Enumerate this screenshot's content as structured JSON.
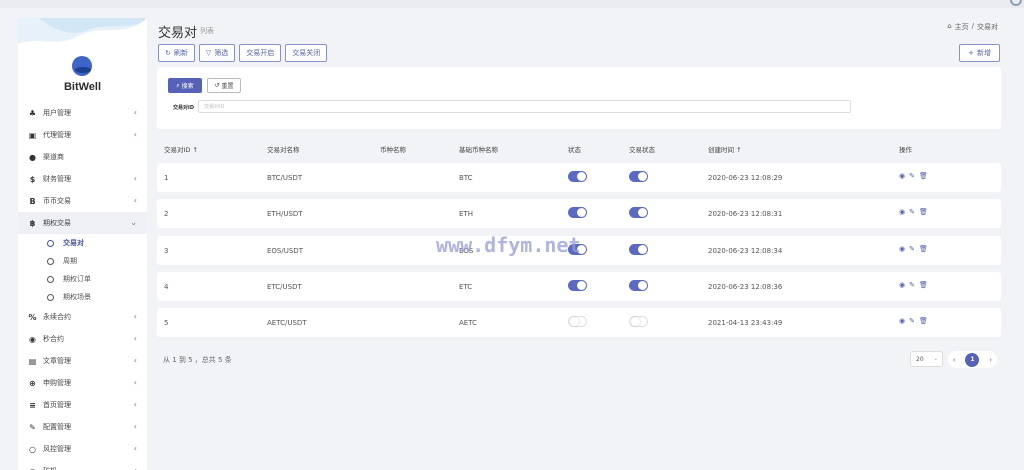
{
  "app": {
    "brand": "BitWell"
  },
  "sidebar": {
    "items": [
      {
        "icon": "♣",
        "label": "用户管理",
        "chevron": "‹"
      },
      {
        "icon": "▣",
        "label": "代理管理",
        "chevron": "‹"
      },
      {
        "icon": "●",
        "label": "渠道商",
        "chevron": ""
      },
      {
        "icon": "$",
        "label": "财务管理",
        "chevron": "‹"
      },
      {
        "icon": "B",
        "label": "币币交易",
        "chevron": "‹"
      },
      {
        "icon": "฿",
        "label": "期权交易",
        "chevron": "⌄"
      }
    ],
    "sub_items": [
      {
        "label": "交易对"
      },
      {
        "label": "周期"
      },
      {
        "label": "期权订单"
      },
      {
        "label": "期权场景"
      }
    ],
    "items_after": [
      {
        "icon": "%",
        "label": "永续合约",
        "chevron": "‹"
      },
      {
        "icon": "◉",
        "label": "秒合约",
        "chevron": "‹"
      },
      {
        "icon": "▤",
        "label": "文章管理",
        "chevron": "‹"
      },
      {
        "icon": "⊕",
        "label": "申购管理",
        "chevron": "‹"
      },
      {
        "icon": "≡",
        "label": "首页管理",
        "chevron": "‹"
      },
      {
        "icon": "✎",
        "label": "配置管理",
        "chevron": "‹"
      },
      {
        "icon": "○",
        "label": "风控管理",
        "chevron": "‹"
      },
      {
        "icon": "○",
        "label": "矿机",
        "chevron": "‹"
      }
    ]
  },
  "header": {
    "title": "交易对",
    "subtitle": "列表",
    "breadcrumb": {
      "home_icon": "⌂",
      "home": "主页",
      "sep": "/",
      "current": "交易对"
    }
  },
  "toolbar": {
    "refresh": {
      "icon": "↻",
      "label": "刷新"
    },
    "filter": {
      "icon": "▽",
      "label": "筛选"
    },
    "open": {
      "label": "交易开启"
    },
    "close": {
      "label": "交易关闭"
    },
    "add": {
      "icon": "+",
      "label": "新增"
    }
  },
  "search": {
    "search_icon": "⌕",
    "search_label": "搜索",
    "reset_icon": "↺",
    "reset_label": "重置",
    "field_label": "交易对ID",
    "field_placeholder": "交易对ID"
  },
  "table": {
    "headers": {
      "id": "交易对ID ↑",
      "name": "交易对名称",
      "coin": "币种名称",
      "base": "基础币种名称",
      "status": "状态",
      "trade": "交易状态",
      "created": "创建时间 ↑",
      "ops": "操作"
    },
    "rows": [
      {
        "id": "1",
        "name": "BTC/USDT",
        "coin": "",
        "base": "BTC",
        "status": true,
        "trade": true,
        "created": "2020-06-23 12:08:29"
      },
      {
        "id": "2",
        "name": "ETH/USDT",
        "coin": "",
        "base": "ETH",
        "status": true,
        "trade": true,
        "created": "2020-06-23 12:08:31"
      },
      {
        "id": "3",
        "name": "EOS/USDT",
        "coin": "",
        "base": "EOS",
        "status": true,
        "trade": true,
        "created": "2020-06-23 12:08:34"
      },
      {
        "id": "4",
        "name": "ETC/USDT",
        "coin": "",
        "base": "ETC",
        "status": true,
        "trade": true,
        "created": "2020-06-23 12:08:36"
      },
      {
        "id": "5",
        "name": "AETC/USDT",
        "coin": "",
        "base": "AETC",
        "status": false,
        "trade": false,
        "created": "2021-04-13 23:43:49"
      }
    ],
    "action_icons": {
      "view": "◉",
      "edit": "✎",
      "delete": "🗑"
    }
  },
  "footer": {
    "info": "从 1 到 5 ，总共 5 条",
    "page_size": "20",
    "page_size_arrow": "⌄",
    "prev": "‹",
    "current_page": "1",
    "next": "›"
  },
  "watermark": "www.dfym.net",
  "colors": {
    "accent": "#5562b8",
    "toggle_on": "#5a6ac3"
  }
}
